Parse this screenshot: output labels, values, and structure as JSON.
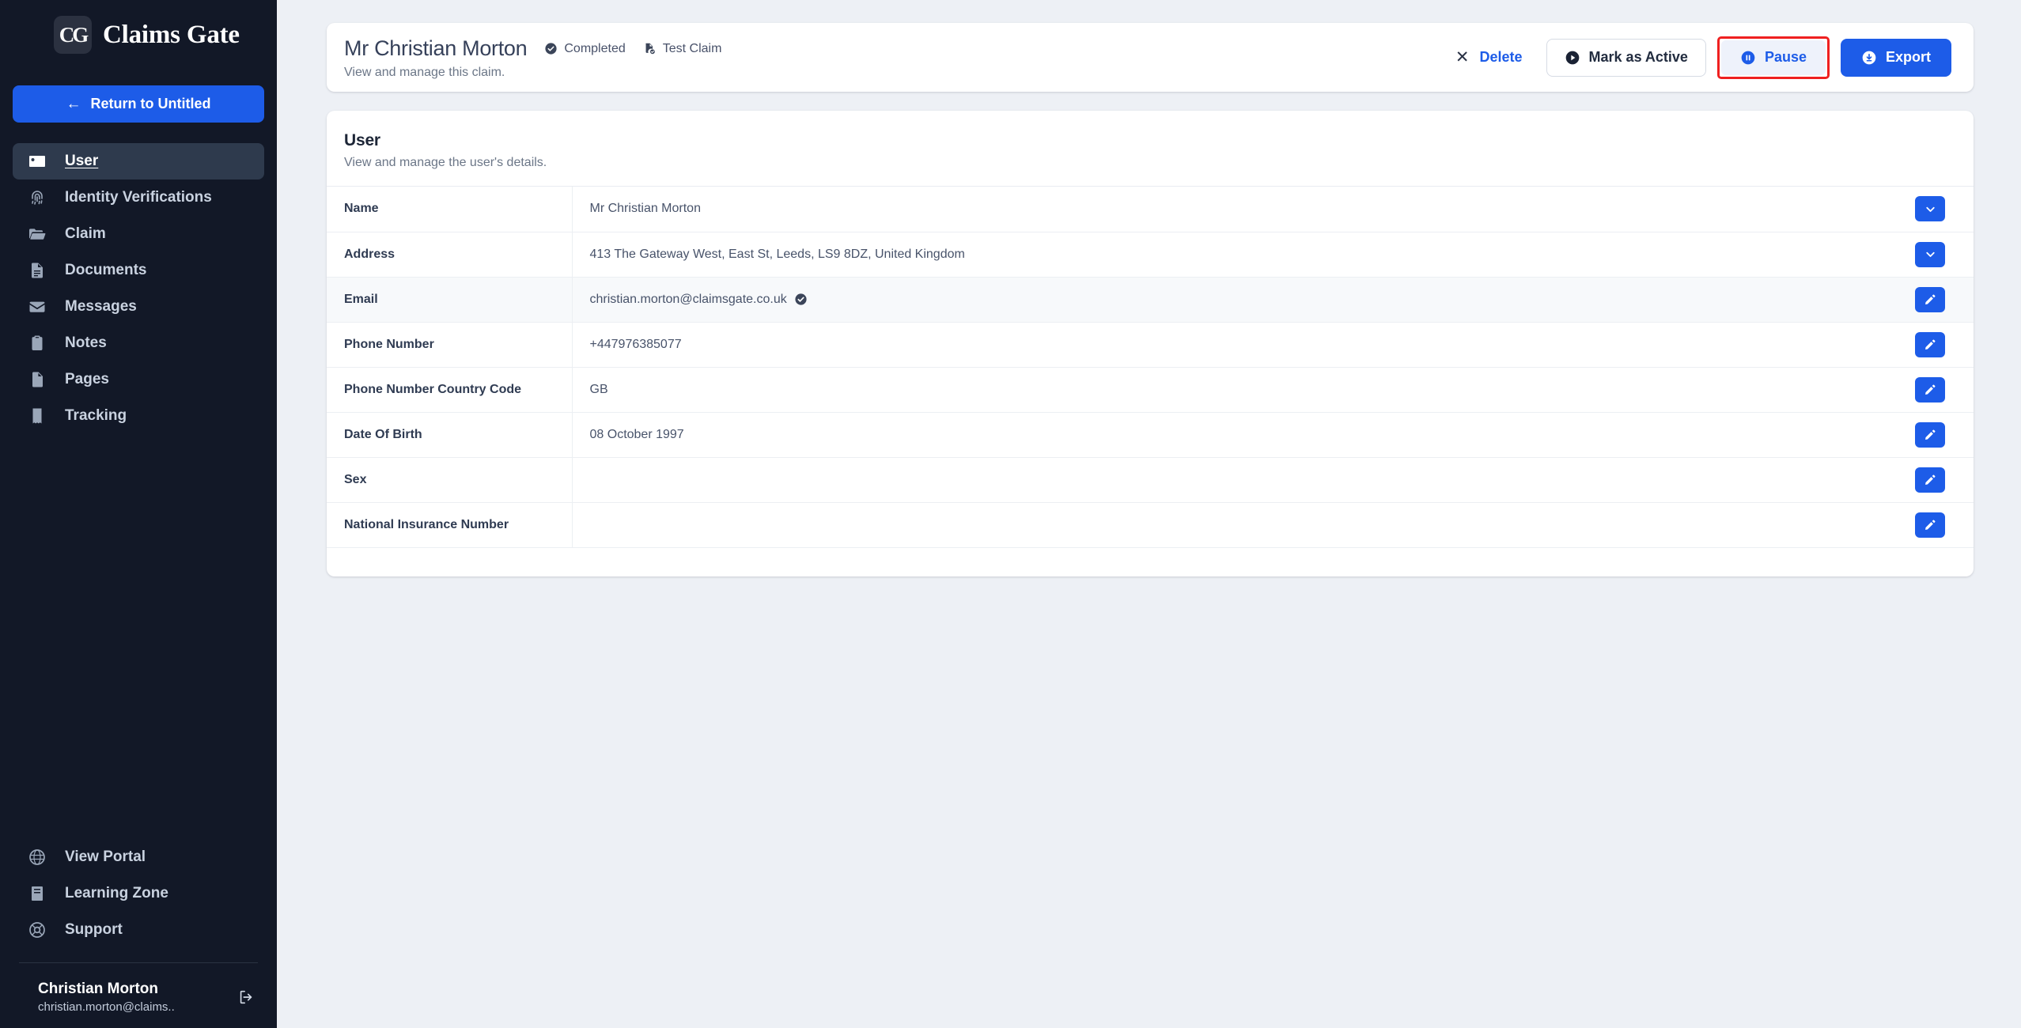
{
  "brand": {
    "mark": "CG",
    "name": "Claims Gate"
  },
  "sidebar": {
    "return_button": {
      "label": "Return to Untitled",
      "arrow": "←"
    },
    "items": [
      {
        "label": "User",
        "icon": "id-card-icon",
        "active": true
      },
      {
        "label": "Identity Verifications",
        "icon": "fingerprint-icon",
        "active": false
      },
      {
        "label": "Claim",
        "icon": "folder-open-icon",
        "active": false
      },
      {
        "label": "Documents",
        "icon": "document-text-icon",
        "active": false
      },
      {
        "label": "Messages",
        "icon": "envelope-icon",
        "active": false
      },
      {
        "label": "Notes",
        "icon": "clipboard-icon",
        "active": false
      },
      {
        "label": "Pages",
        "icon": "page-icon",
        "active": false
      },
      {
        "label": "Tracking",
        "icon": "receipt-icon",
        "active": false
      }
    ],
    "bottom_items": [
      {
        "label": "View Portal",
        "icon": "globe-icon"
      },
      {
        "label": "Learning Zone",
        "icon": "book-icon"
      },
      {
        "label": "Support",
        "icon": "lifebuoy-icon"
      }
    ],
    "account": {
      "name": "Christian Morton",
      "email": "christian.morton@claims..",
      "logout_icon": "logout-icon"
    }
  },
  "header": {
    "title": "Mr Christian Morton",
    "subtitle": "View and manage this claim.",
    "badges": [
      {
        "label": "Completed",
        "icon": "check-circle-icon"
      },
      {
        "label": "Test Claim",
        "icon": "test-document-icon"
      }
    ],
    "actions": {
      "delete": {
        "label": "Delete",
        "icon": "x-icon"
      },
      "mark_active": {
        "label": "Mark as Active",
        "icon": "play-circle-icon"
      },
      "pause": {
        "label": "Pause",
        "icon": "pause-circle-icon",
        "highlighted": true
      },
      "export": {
        "label": "Export",
        "icon": "download-circle-icon"
      }
    }
  },
  "user_card": {
    "title": "User",
    "subtitle": "View and manage the user's details.",
    "rows": [
      {
        "label": "Name",
        "value": "Mr Christian Morton",
        "verified": false,
        "action": "chevron-down-icon",
        "alt": false
      },
      {
        "label": "Address",
        "value": "413 The Gateway West, East St, Leeds, LS9 8DZ, United Kingdom",
        "verified": false,
        "action": "chevron-down-icon",
        "alt": false
      },
      {
        "label": "Email",
        "value": "christian.morton@claimsgate.co.uk",
        "verified": true,
        "action": "pencil-icon",
        "alt": true
      },
      {
        "label": "Phone Number",
        "value": "+447976385077",
        "verified": false,
        "action": "pencil-icon",
        "alt": false
      },
      {
        "label": "Phone Number Country Code",
        "value": "GB",
        "verified": false,
        "action": "pencil-icon",
        "alt": false
      },
      {
        "label": "Date Of Birth",
        "value": "08 October 1997",
        "verified": false,
        "action": "pencil-icon",
        "alt": false
      },
      {
        "label": "Sex",
        "value": "",
        "verified": false,
        "action": "pencil-icon",
        "alt": false
      },
      {
        "label": "National Insurance Number",
        "value": "",
        "verified": false,
        "action": "pencil-icon",
        "alt": false
      }
    ]
  },
  "colors": {
    "accent": "#1d5ce8",
    "sidebar_bg": "#121827",
    "sidebar_active": "#2e3a4d",
    "page_bg": "#edf0f5",
    "highlight": "#ef2020"
  }
}
